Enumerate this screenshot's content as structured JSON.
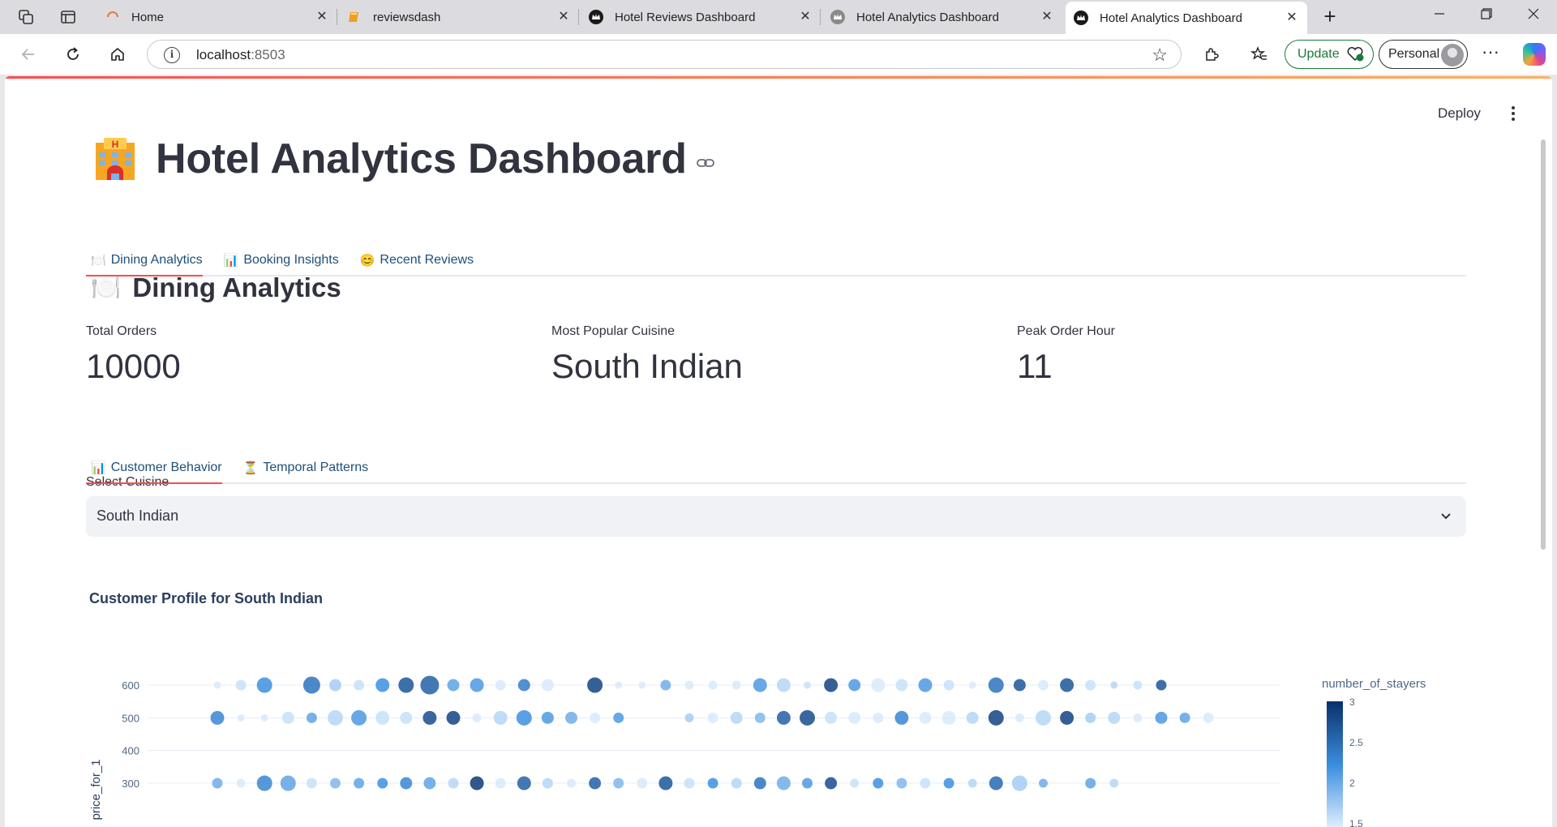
{
  "browser": {
    "tabs": [
      {
        "title": "Home",
        "icon": "spinner-icon"
      },
      {
        "title": "reviewsdash",
        "icon": "book-icon"
      },
      {
        "title": "Hotel Reviews Dashboard",
        "icon": "crown-icon"
      },
      {
        "title": "Hotel Analytics Dashboard",
        "icon": "crown-icon"
      },
      {
        "title": "Hotel Analytics Dashboard",
        "icon": "crown-icon",
        "active": true
      }
    ],
    "url_host": "localhost",
    "url_port": ":8503",
    "update_label": "Update",
    "profile_label": "Personal"
  },
  "app": {
    "deploy_label": "Deploy",
    "title": "Hotel Analytics Dashboard",
    "title_emoji": "hotel-icon",
    "main_tabs": [
      {
        "emoji": "🍽️",
        "label": "Dining Analytics",
        "active": true
      },
      {
        "emoji": "📊",
        "label": "Booking Insights",
        "active": false
      },
      {
        "emoji": "😊",
        "label": "Recent Reviews",
        "active": false
      }
    ],
    "section": {
      "emoji": "🍽️",
      "title": "Dining Analytics"
    },
    "metrics": [
      {
        "label": "Total Orders",
        "value": "10000"
      },
      {
        "label": "Most Popular Cuisine",
        "value": "South Indian"
      },
      {
        "label": "Peak Order Hour",
        "value": "11"
      }
    ],
    "sub_tabs": [
      {
        "emoji": "📊",
        "label": "Customer Behavior",
        "active": true
      },
      {
        "emoji": "⏳",
        "label": "Temporal Patterns",
        "active": false
      }
    ],
    "select": {
      "label": "Select Cuisine",
      "value": "South Indian"
    }
  },
  "chart_data": {
    "type": "scatter",
    "title": "Customer Profile for South Indian",
    "ylabel": "price_for_1",
    "yticks": [
      300,
      400,
      500,
      600
    ],
    "colorbar": {
      "title": "number_of_stayers",
      "ticks": [
        "3",
        "2.5",
        "2",
        "1.5"
      ],
      "range": [
        1,
        3
      ],
      "colors": [
        "#e8f4ff",
        "#3d8fe0",
        "#08306b"
      ]
    },
    "grid": true,
    "rows": [
      {
        "y": 600,
        "points": [
          [
            0,
            1.1,
            5
          ],
          [
            1,
            1.2,
            7
          ],
          [
            2,
            2.0,
            10
          ],
          [
            4,
            2.3,
            11
          ],
          [
            5,
            1.4,
            8
          ],
          [
            6,
            1.2,
            7
          ],
          [
            7,
            2.0,
            9
          ],
          [
            8,
            2.6,
            10
          ],
          [
            9,
            2.5,
            12
          ],
          [
            10,
            1.8,
            8
          ],
          [
            11,
            1.9,
            9
          ],
          [
            12,
            1.1,
            7
          ],
          [
            13,
            2.2,
            8
          ],
          [
            14,
            1.1,
            8
          ],
          [
            16,
            2.8,
            10
          ],
          [
            17,
            1.1,
            5
          ],
          [
            18,
            1.1,
            5
          ],
          [
            19,
            1.7,
            7
          ],
          [
            20,
            1.1,
            6
          ],
          [
            21,
            1.1,
            6
          ],
          [
            22,
            1.1,
            6
          ],
          [
            23,
            1.9,
            9
          ],
          [
            24,
            1.3,
            9
          ],
          [
            25,
            1.2,
            5
          ],
          [
            26,
            2.8,
            9
          ],
          [
            27,
            1.9,
            8
          ],
          [
            28,
            1.1,
            9
          ],
          [
            29,
            1.2,
            8
          ],
          [
            30,
            1.9,
            9
          ],
          [
            31,
            1.2,
            7
          ],
          [
            32,
            1.1,
            5
          ],
          [
            33,
            2.3,
            10
          ],
          [
            34,
            2.6,
            8
          ],
          [
            35,
            1.1,
            7
          ],
          [
            36,
            2.6,
            9
          ],
          [
            37,
            1.2,
            7
          ],
          [
            38,
            1.3,
            5
          ],
          [
            39,
            1.2,
            6
          ],
          [
            40,
            2.6,
            7
          ]
        ]
      },
      {
        "y": 500,
        "points": [
          [
            0,
            2.1,
            9
          ],
          [
            1,
            1.1,
            5
          ],
          [
            2,
            1.1,
            5
          ],
          [
            3,
            1.2,
            8
          ],
          [
            4,
            1.8,
            7
          ],
          [
            5,
            1.3,
            10
          ],
          [
            6,
            1.9,
            10
          ],
          [
            7,
            1.2,
            9
          ],
          [
            8,
            1.2,
            8
          ],
          [
            9,
            2.7,
            9
          ],
          [
            10,
            2.8,
            9
          ],
          [
            11,
            1.1,
            6
          ],
          [
            12,
            1.3,
            9
          ],
          [
            13,
            2.0,
            10
          ],
          [
            14,
            1.9,
            8
          ],
          [
            15,
            1.7,
            8
          ],
          [
            16,
            1.1,
            7
          ],
          [
            17,
            1.9,
            7
          ],
          [
            20,
            1.4,
            6
          ],
          [
            21,
            1.1,
            7
          ],
          [
            22,
            1.3,
            8
          ],
          [
            23,
            1.6,
            7
          ],
          [
            24,
            2.5,
            9
          ],
          [
            25,
            2.7,
            10
          ],
          [
            26,
            1.2,
            8
          ],
          [
            27,
            1.1,
            8
          ],
          [
            28,
            1.1,
            7
          ],
          [
            29,
            2.1,
            9
          ],
          [
            30,
            1.1,
            8
          ],
          [
            31,
            1.1,
            9
          ],
          [
            32,
            1.3,
            8
          ],
          [
            33,
            2.8,
            10
          ],
          [
            34,
            1.1,
            6
          ],
          [
            35,
            1.3,
            10
          ],
          [
            36,
            2.8,
            9
          ],
          [
            37,
            1.4,
            7
          ],
          [
            38,
            1.3,
            8
          ],
          [
            39,
            1.1,
            6
          ],
          [
            40,
            1.9,
            8
          ],
          [
            41,
            1.8,
            7
          ],
          [
            42,
            1.1,
            7
          ]
        ]
      },
      {
        "y": 300,
        "points": [
          [
            0,
            1.7,
            7
          ],
          [
            1,
            1.1,
            6
          ],
          [
            2,
            2.1,
            10
          ],
          [
            3,
            1.8,
            10
          ],
          [
            4,
            1.2,
            7
          ],
          [
            5,
            1.6,
            7
          ],
          [
            6,
            1.8,
            7
          ],
          [
            7,
            2.0,
            7
          ],
          [
            8,
            2.1,
            8
          ],
          [
            9,
            1.8,
            8
          ],
          [
            10,
            1.3,
            7
          ],
          [
            11,
            2.9,
            9
          ],
          [
            12,
            1.1,
            7
          ],
          [
            13,
            2.5,
            9
          ],
          [
            14,
            1.3,
            7
          ],
          [
            15,
            1.1,
            6
          ],
          [
            16,
            2.5,
            8
          ],
          [
            17,
            1.6,
            7
          ],
          [
            18,
            1.1,
            7
          ],
          [
            19,
            2.6,
            9
          ],
          [
            20,
            1.2,
            7
          ],
          [
            21,
            2.0,
            7
          ],
          [
            22,
            1.3,
            7
          ],
          [
            23,
            2.3,
            8
          ],
          [
            24,
            1.7,
            9
          ],
          [
            25,
            1.9,
            7
          ],
          [
            26,
            2.7,
            8
          ],
          [
            27,
            1.2,
            6
          ],
          [
            28,
            2.0,
            7
          ],
          [
            29,
            1.6,
            7
          ],
          [
            30,
            1.2,
            7
          ],
          [
            31,
            2.0,
            7
          ],
          [
            32,
            1.3,
            6
          ],
          [
            33,
            2.4,
            9
          ],
          [
            34,
            1.4,
            10
          ],
          [
            35,
            1.7,
            6
          ],
          [
            37,
            1.8,
            7
          ],
          [
            38,
            1.3,
            6
          ]
        ]
      }
    ]
  }
}
